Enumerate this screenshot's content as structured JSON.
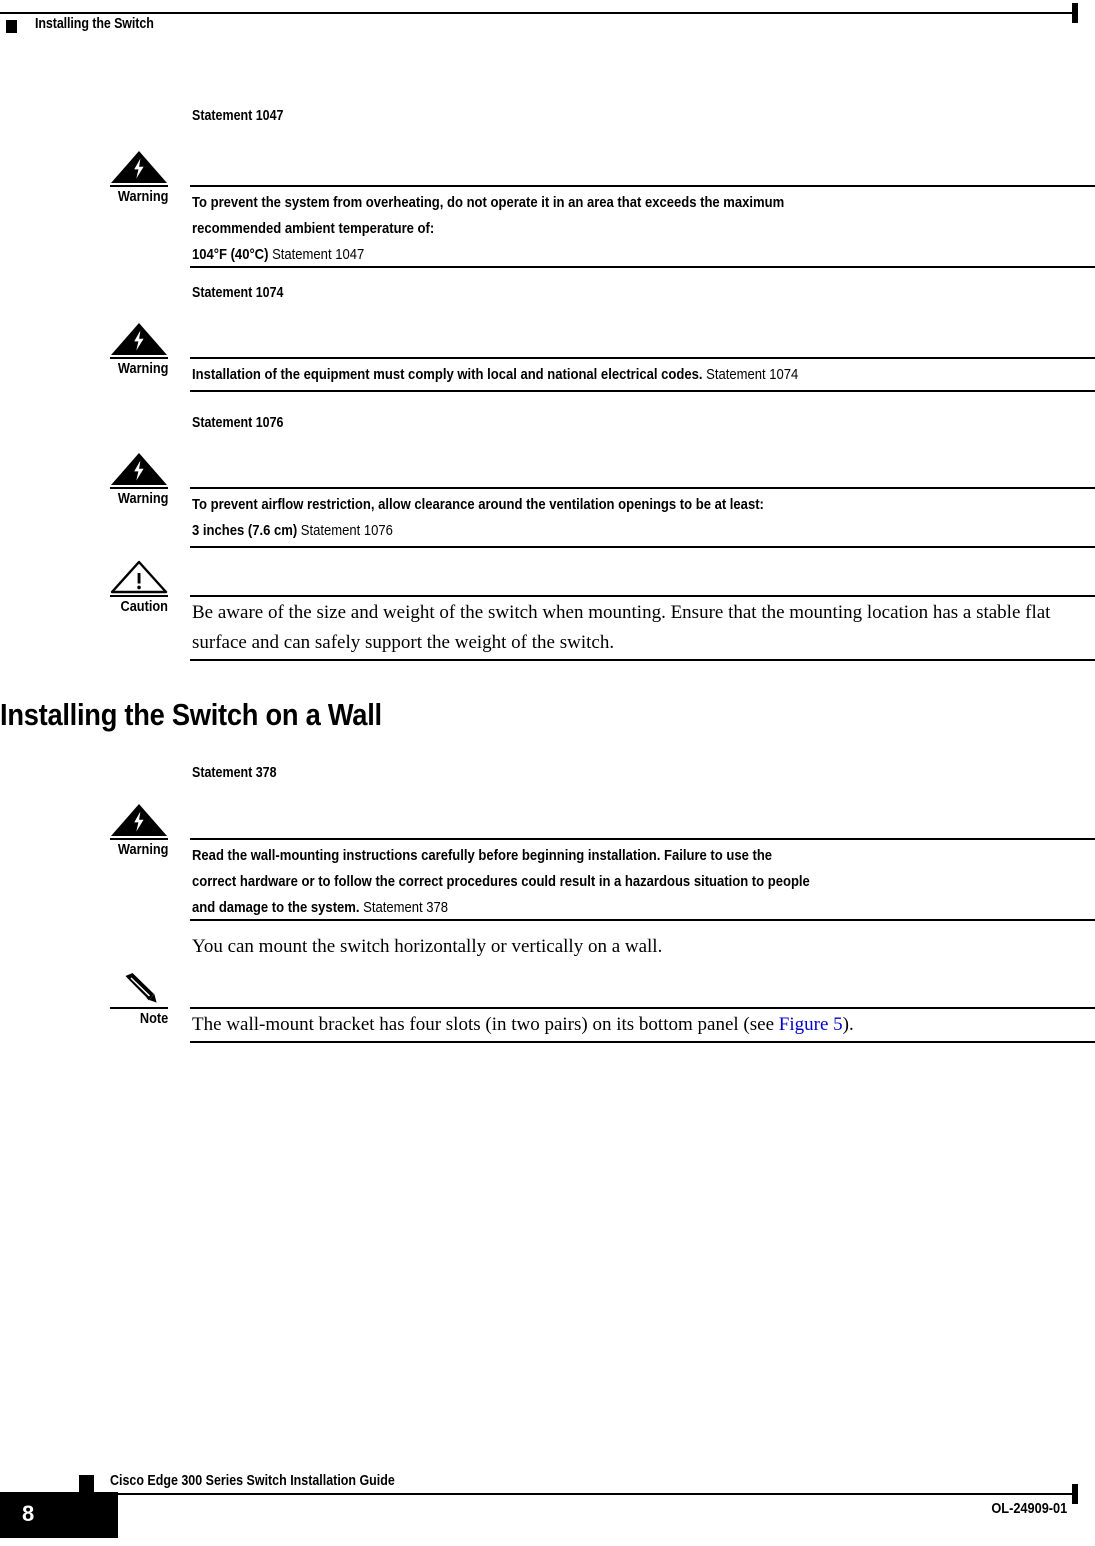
{
  "header": {
    "running_title": "Installing the Switch",
    "bullet_icon": "black-square-icon"
  },
  "admonitions": [
    {
      "statement_head": "Statement 1047",
      "icon": "warning-lightning-triangle-icon",
      "label": "Warning",
      "body_bold_lines": [
        "To prevent the system from overheating, do not operate it in an area that exceeds the maximum",
        "recommended ambient temperature of:",
        "104°F (40°C)"
      ],
      "body_ref": "Statement 1047"
    },
    {
      "statement_head": "Statement 1074",
      "icon": "warning-lightning-triangle-icon",
      "label": "Warning",
      "body_bold_lines": [
        "Installation of the equipment must comply with local and national electrical codes."
      ],
      "body_ref": "Statement 1074"
    },
    {
      "statement_head": "Statement 1076",
      "icon": "warning-lightning-triangle-icon",
      "label": "Warning",
      "body_bold_lines": [
        "To prevent airflow restriction, allow clearance around the ventilation openings to be at least:",
        "3 inches (7.6 cm)"
      ],
      "body_ref": "Statement 1076"
    },
    {
      "statement_head": "",
      "icon": "caution-exclamation-triangle-icon",
      "label": "Caution",
      "serif_body": "Be aware of the size and weight of the switch when mounting. Ensure that the mounting location has a stable flat surface and can safely support the weight of the switch."
    }
  ],
  "section": {
    "heading": "Installing the Switch on a Wall"
  },
  "wall_admonitions": [
    {
      "statement_head": "Statement 378",
      "icon": "warning-lightning-triangle-icon",
      "label": "Warning",
      "body_bold_lines": [
        "Read the wall-mounting instructions carefully before beginning installation. Failure to use the",
        "correct hardware or to follow the correct procedures could result in a hazardous situation to people",
        "and damage to the system."
      ],
      "body_ref": "Statement 378"
    }
  ],
  "paragraph": {
    "text": "You can mount the switch horizontally or vertically on a wall."
  },
  "note": {
    "icon": "pencil-note-icon",
    "label": "Note",
    "text_before_link": "The wall-mount bracket has four slots (in two pairs) on its bottom panel (see ",
    "link_text": "Figure 5",
    "text_after_link": ")."
  },
  "footer": {
    "page_number": "8",
    "guide_title": "Cisco Edge 300 Series Switch Installation Guide",
    "doc_id": "OL-24909-01",
    "bullet_icon": "black-square-icon"
  },
  "colors": {
    "ink": "#000000",
    "link": "#0000cc",
    "page": "#ffffff"
  }
}
